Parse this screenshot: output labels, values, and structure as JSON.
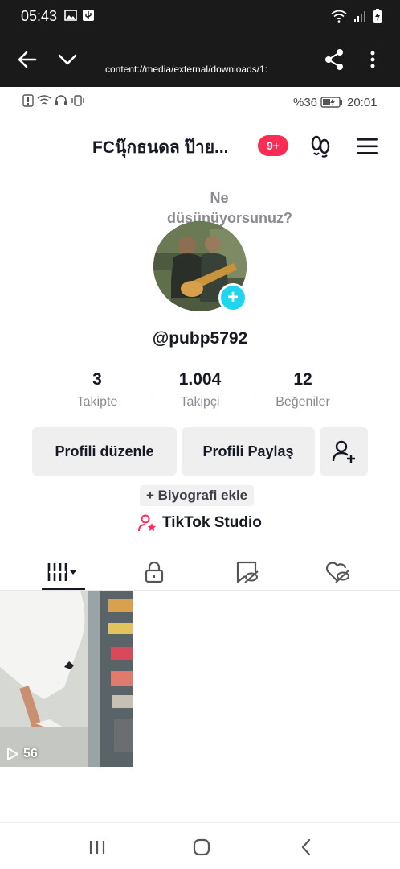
{
  "system_bar": {
    "time": "05:43"
  },
  "viewer": {
    "url": "content://media/external/downloads/1:"
  },
  "inner_status": {
    "battery": "%36",
    "time": "20:01"
  },
  "header": {
    "title": "FCนุ๊กธนดล ป๊าย...",
    "notification_badge": "9+"
  },
  "profile": {
    "note": "Ne düşünüyorsunuz?",
    "username": "@pubp5792",
    "stats": [
      {
        "value": "3",
        "label": "Takipte"
      },
      {
        "value": "1.004",
        "label": "Takipçi"
      },
      {
        "value": "12",
        "label": "Beğeniler"
      }
    ],
    "edit_button": "Profili düzenle",
    "share_button": "Profili Paylaş",
    "add_bio": "+ Biyografi ekle",
    "studio": "TikTok Studio"
  },
  "tabs": [
    "videos-grid",
    "private",
    "reposts",
    "liked"
  ],
  "videos": [
    {
      "views": "56"
    }
  ],
  "colors": {
    "accent_red": "#fe2c55",
    "avatar_add": "#20d5ec",
    "text": "#161823",
    "muted": "#8a8b91"
  }
}
